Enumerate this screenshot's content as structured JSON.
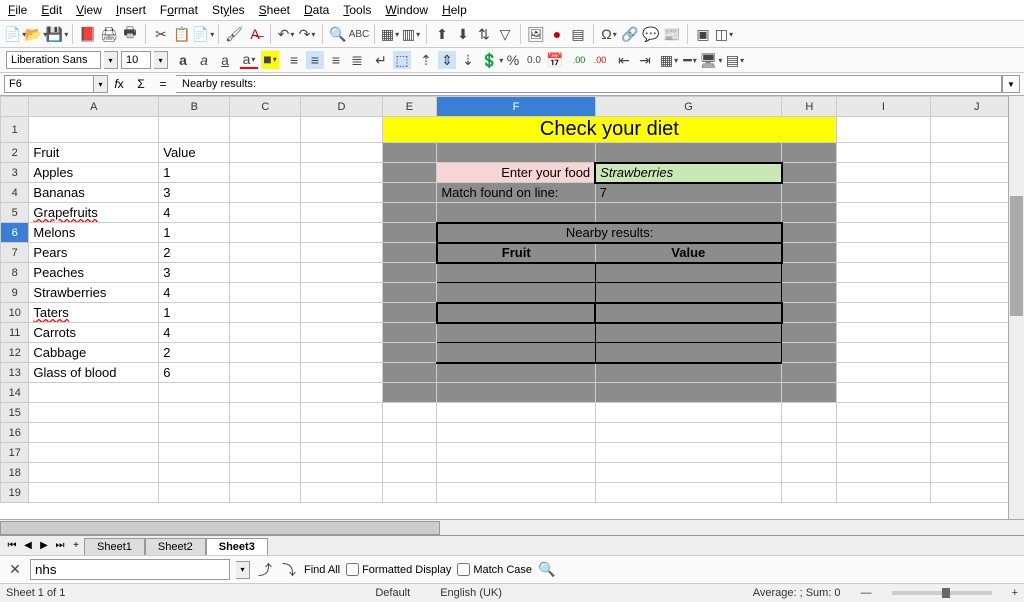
{
  "menus": [
    "File",
    "Edit",
    "View",
    "Insert",
    "Format",
    "Styles",
    "Sheet",
    "Data",
    "Tools",
    "Window",
    "Help"
  ],
  "font": {
    "name": "Liberation Sans",
    "size": "10"
  },
  "cell_ref": "F6",
  "formula": "Nearby results:",
  "columns": [
    "A",
    "B",
    "C",
    "D",
    "E",
    "F",
    "G",
    "H",
    "I",
    "J"
  ],
  "rows": [
    "1",
    "2",
    "3",
    "4",
    "5",
    "6",
    "7",
    "8",
    "9",
    "10",
    "11",
    "12",
    "13",
    "14",
    "15",
    "16",
    "17",
    "18",
    "19"
  ],
  "data": {
    "A2": "Fruit",
    "B2": "Value",
    "A3": "Apples",
    "B3": "1",
    "A4": "Bananas",
    "B4": "3",
    "A5": "Grapefruits",
    "B5": "4",
    "A6": "Melons",
    "B6": "1",
    "A7": "Pears",
    "B7": "2",
    "A8": "Peaches",
    "B8": "3",
    "A9": "Strawberries",
    "B9": "4",
    "A10": "Taters",
    "B10": "1",
    "A11": "Carrots",
    "B11": "4",
    "A12": "Cabbage",
    "B12": "2",
    "A13": "Glass of blood",
    "B13": "6",
    "banner": "Check your diet",
    "F3": "Enter your food",
    "G3": "Strawberries",
    "F4": "Match found on line:",
    "G4": "7",
    "F6": "Nearby results:",
    "F7": "Fruit",
    "G7": "Value"
  },
  "tabs": [
    "Sheet1",
    "Sheet2",
    "Sheet3"
  ],
  "active_tab": "Sheet3",
  "find": {
    "value": "nhs",
    "findall": "Find All",
    "fmt": "Formatted Display",
    "match": "Match Case"
  },
  "status": {
    "sheet": "Sheet 1 of 1",
    "style": "Default",
    "lang": "English (UK)",
    "summary": "Average: ; Sum: 0"
  }
}
